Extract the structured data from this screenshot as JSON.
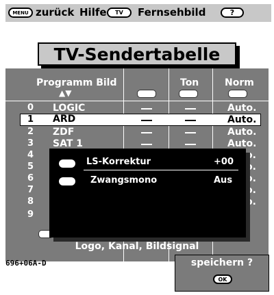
{
  "help_bar": {
    "menu_key": "MENU",
    "back_label": "zurück",
    "help_label": "Hilfe",
    "tv_key": "TV",
    "tv_label": "Fernsehbild",
    "help_key": "?"
  },
  "title": "TV-Sendertabelle",
  "table": {
    "headers": {
      "programm_bild": "Programm Bild",
      "sort_arrows": "▲▼",
      "ton": "Ton",
      "norm": "Norm"
    },
    "rows": [
      {
        "num": "0",
        "name": "LOGIC",
        "norm": "Auto."
      },
      {
        "num": "1",
        "name": "ARD",
        "norm": "Auto."
      },
      {
        "num": "2",
        "name": "ZDF",
        "norm": "Auto."
      },
      {
        "num": "3",
        "name": "SAT 1",
        "norm": "Auto."
      },
      {
        "num": "4",
        "name": "",
        "norm": "o."
      },
      {
        "num": "5",
        "name": "",
        "norm": "o."
      },
      {
        "num": "6",
        "name": "",
        "norm": "o."
      },
      {
        "num": "7",
        "name": "",
        "norm": "o."
      },
      {
        "num": "8",
        "name": "",
        "norm": "o."
      },
      {
        "num": "9",
        "name": "",
        "norm": ""
      }
    ],
    "selected_row": 1
  },
  "dialog": {
    "items": [
      {
        "label": "LS-Korrektur",
        "value": "+00"
      },
      {
        "label": "Zwangsmono",
        "value": "Aus"
      }
    ]
  },
  "bottom_label": "Logo, Kanal, Bildsignal",
  "code": "696+06A-D",
  "store_popup": {
    "text": "speichern ?",
    "ok_key": "OK"
  }
}
